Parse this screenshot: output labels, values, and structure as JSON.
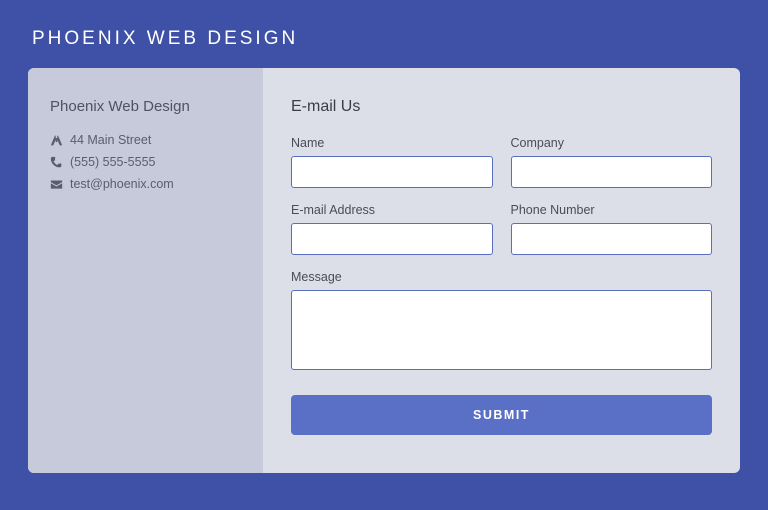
{
  "header": {
    "title": "PHOENIX WEB DESIGN"
  },
  "sidebar": {
    "company_name": "Phoenix Web Design",
    "address": "44 Main Street",
    "phone": "(555) 555-5555",
    "email": "test@phoenix.com"
  },
  "form": {
    "heading": "E-mail Us",
    "labels": {
      "name": "Name",
      "company": "Company",
      "email": "E-mail Address",
      "phone": "Phone Number",
      "message": "Message"
    },
    "values": {
      "name": "",
      "company": "",
      "email": "",
      "phone": "",
      "message": ""
    },
    "submit_label": "SUBMIT"
  }
}
